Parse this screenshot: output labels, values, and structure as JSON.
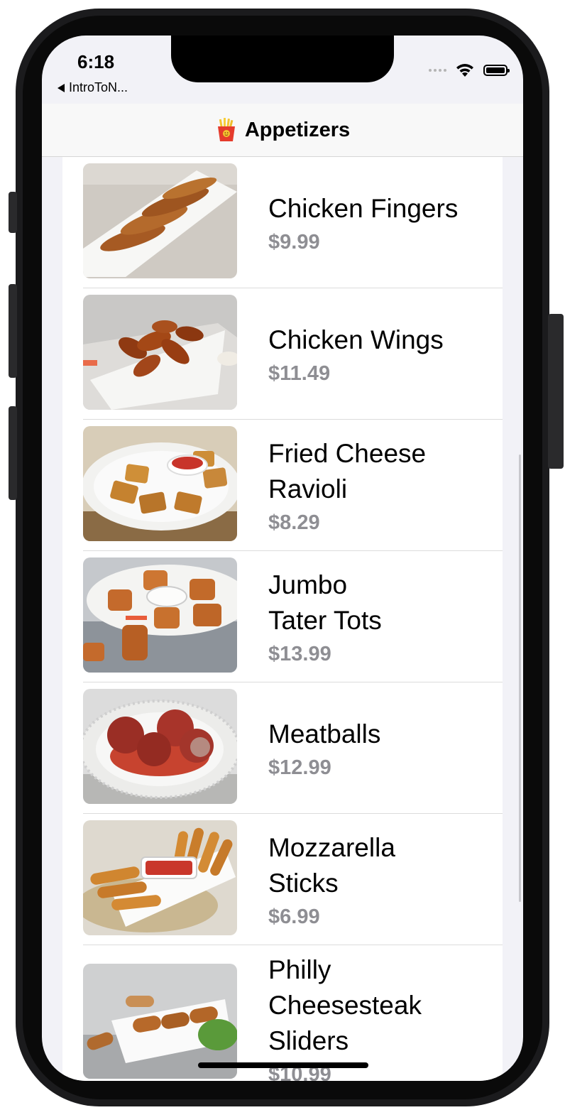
{
  "status_bar": {
    "time": "6:18",
    "back_label": "IntroToN..."
  },
  "nav": {
    "title": "Appetizers",
    "icon": "fries-emoji-icon"
  },
  "items": [
    {
      "name": "Chicken Fingers",
      "price": "$9.99",
      "image": "chicken-fingers"
    },
    {
      "name": "Chicken Wings",
      "price": "$11.49",
      "image": "chicken-wings"
    },
    {
      "name": "Fried Cheese\nRavioli",
      "price": "$8.29",
      "image": "fried-cheese-ravioli"
    },
    {
      "name": "Jumbo\nTater Tots",
      "price": "$13.99",
      "image": "jumbo-tater-tots"
    },
    {
      "name": "Meatballs",
      "price": "$12.99",
      "image": "meatballs"
    },
    {
      "name": "Mozzarella\nSticks",
      "price": "$6.99",
      "image": "mozzarella-sticks"
    },
    {
      "name": "Philly\nCheesesteak\nSliders",
      "price": "$10.99",
      "image": "philly-cheesesteak-sliders"
    }
  ],
  "colors": {
    "price": "#8e8e93",
    "list_bg": "#ffffff",
    "grouped_bg": "#f2f2f7"
  }
}
